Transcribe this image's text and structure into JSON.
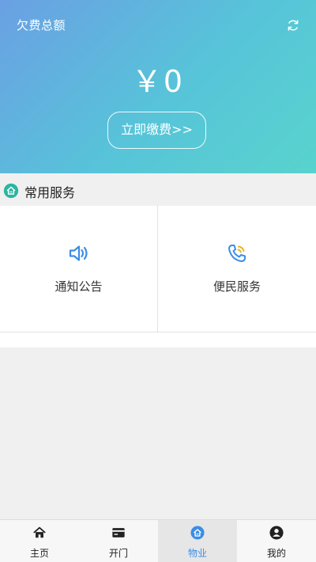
{
  "header": {
    "title": "欠费总额",
    "amount": "￥0",
    "pay_button": "立即缴费>>",
    "refresh_icon": "refresh-icon"
  },
  "section": {
    "title": "常用服务",
    "icon": "house-badge-icon",
    "accent_color": "#2bb5a1"
  },
  "services": [
    {
      "label": "通知公告",
      "icon": "speaker-icon"
    },
    {
      "label": "便民服务",
      "icon": "phone-call-icon"
    }
  ],
  "tabbar": {
    "items": [
      {
        "label": "主页",
        "icon": "home-icon"
      },
      {
        "label": "开门",
        "icon": "card-icon"
      },
      {
        "label": "物业",
        "icon": "property-icon"
      },
      {
        "label": "我的",
        "icon": "user-icon"
      }
    ],
    "active_index": 2,
    "active_color": "#3a8ee6"
  }
}
